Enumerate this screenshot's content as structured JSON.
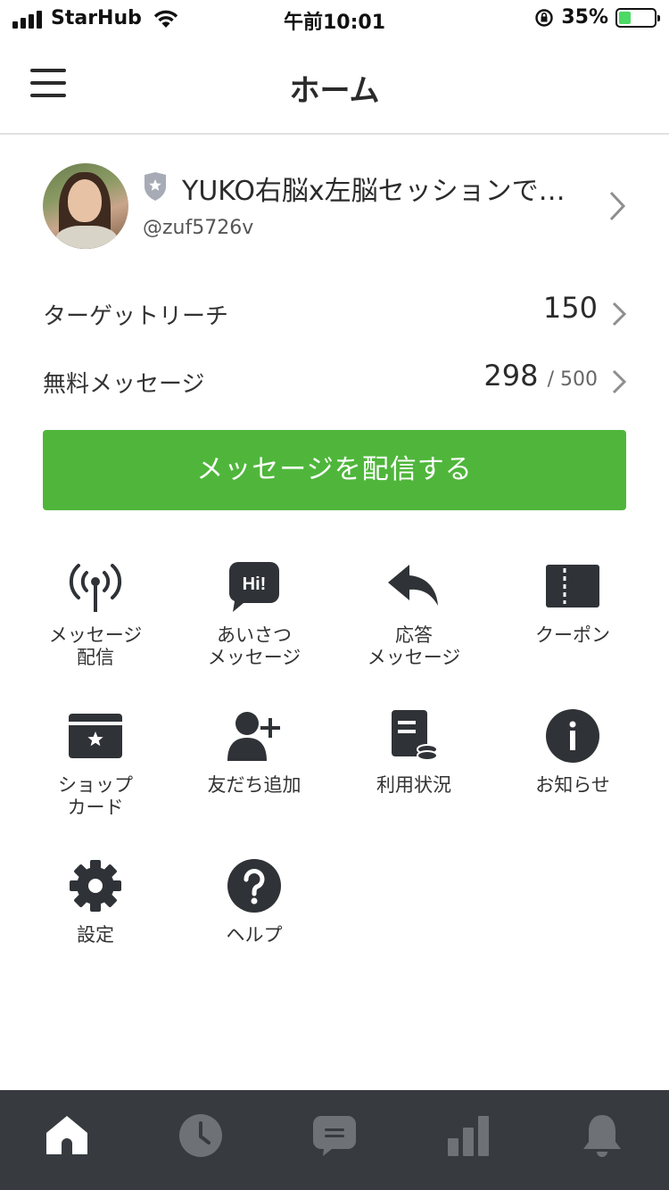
{
  "status_bar": {
    "carrier": "StarHub",
    "time": "午前10:01",
    "battery_percent": "35%",
    "battery_level": 0.35
  },
  "header": {
    "title": "ホーム"
  },
  "profile": {
    "name": "YUKO右脳x左脳セッションで…",
    "account_id": "@zuf5726v"
  },
  "stats": {
    "target_reach_label": "ターゲットリーチ",
    "target_reach_value": "150",
    "free_messages_label": "無料メッセージ",
    "free_messages_value": "298",
    "free_messages_limit": "/ 500"
  },
  "send_button": {
    "label": "メッセージを配信する"
  },
  "menu": {
    "message_broadcast": "メッセージ\n配信",
    "greeting_message": "あいさつ\nメッセージ",
    "response_message": "応答\nメッセージ",
    "coupon": "クーポン",
    "shop_card": "ショップ\nカード",
    "add_friends": "友だち追加",
    "usage_status": "利用状況",
    "notices": "お知らせ",
    "settings": "設定",
    "help": "ヘルプ",
    "hi_icon_text": "Hi!"
  },
  "bottom_nav": {
    "icons": [
      "home-icon",
      "clock-icon",
      "chat-icon",
      "chart-icon",
      "bell-icon"
    ],
    "active": "home-icon"
  },
  "colors": {
    "accent_green": "#4fb63b",
    "nav_bg": "#373b40",
    "icon_dark": "#2f3236"
  }
}
